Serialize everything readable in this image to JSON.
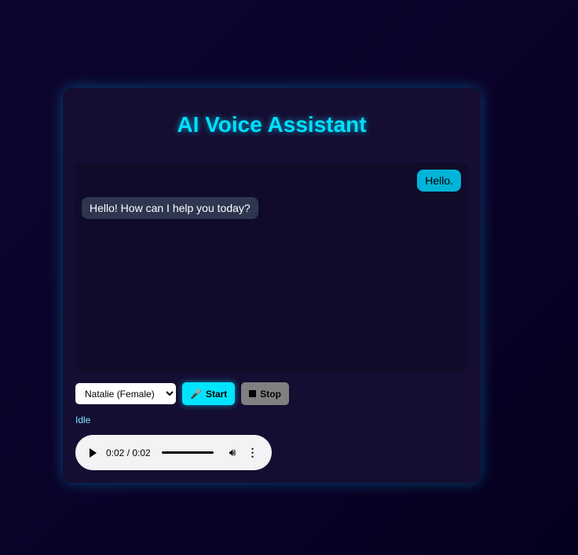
{
  "app": {
    "title": "AI Voice Assistant"
  },
  "chat": {
    "messages": [
      {
        "role": "user",
        "text": "Hello."
      },
      {
        "role": "assistant",
        "text": "Hello! How can I help you today?"
      }
    ]
  },
  "controls": {
    "voice_selected": "Natalie (Female)",
    "start_label": "Start",
    "start_icon": "microphone-icon",
    "stop_label": "Stop",
    "stop_icon": "stop-square-icon"
  },
  "status": "Idle",
  "audio": {
    "time": "0:02 / 0:02",
    "progress": 1.0
  },
  "colors": {
    "accent": "#00e5ff",
    "user_bubble": "#00b4d8",
    "bot_bubble": "#2e3650",
    "stop": "#808080"
  }
}
